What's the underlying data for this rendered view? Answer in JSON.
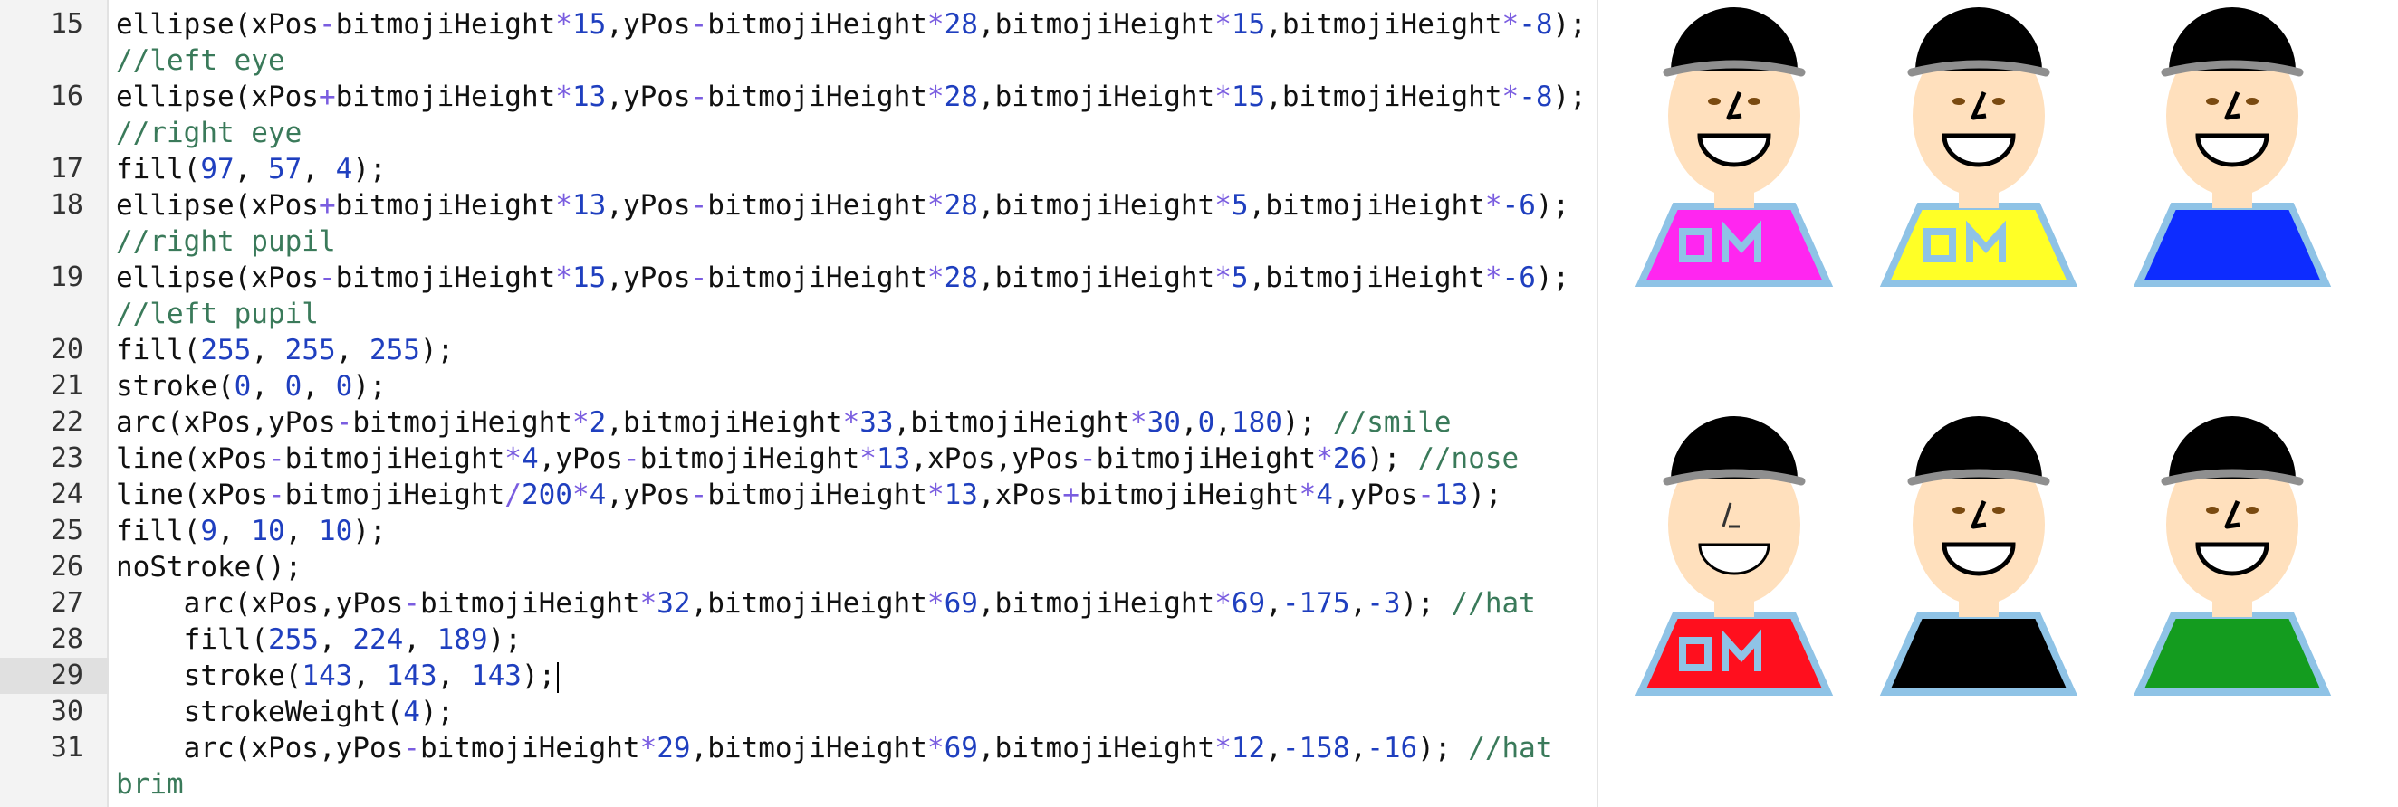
{
  "editor": {
    "active_line": "29",
    "lines": [
      {
        "n": "15",
        "tokens": [
          [
            "t",
            "ellipse(xPos"
          ],
          [
            "o",
            "-"
          ],
          [
            "t",
            "bitmojiHeight"
          ],
          [
            "o",
            "*"
          ],
          [
            "n",
            "15"
          ],
          [
            "t",
            ",yPos"
          ],
          [
            "o",
            "-"
          ],
          [
            "t",
            "bitmojiHeight"
          ],
          [
            "o",
            "*"
          ],
          [
            "n",
            "28"
          ],
          [
            "t",
            ",bitmojiHeight"
          ],
          [
            "o",
            "*"
          ],
          [
            "n",
            "15"
          ],
          [
            "t",
            ",bitmojiHeight"
          ],
          [
            "o",
            "*"
          ],
          [
            "n",
            "-8"
          ],
          [
            "t",
            ");"
          ]
        ]
      },
      {
        "n": "",
        "tokens": [
          [
            "c",
            "//left eye"
          ]
        ]
      },
      {
        "n": "16",
        "tokens": [
          [
            "t",
            "ellipse(xPos"
          ],
          [
            "o",
            "+"
          ],
          [
            "t",
            "bitmojiHeight"
          ],
          [
            "o",
            "*"
          ],
          [
            "n",
            "13"
          ],
          [
            "t",
            ",yPos"
          ],
          [
            "o",
            "-"
          ],
          [
            "t",
            "bitmojiHeight"
          ],
          [
            "o",
            "*"
          ],
          [
            "n",
            "28"
          ],
          [
            "t",
            ",bitmojiHeight"
          ],
          [
            "o",
            "*"
          ],
          [
            "n",
            "15"
          ],
          [
            "t",
            ",bitmojiHeight"
          ],
          [
            "o",
            "*"
          ],
          [
            "n",
            "-8"
          ],
          [
            "t",
            ");"
          ]
        ]
      },
      {
        "n": "",
        "tokens": [
          [
            "c",
            "//right eye"
          ]
        ]
      },
      {
        "n": "17",
        "tokens": [
          [
            "t",
            "fill("
          ],
          [
            "n",
            "97"
          ],
          [
            "t",
            ", "
          ],
          [
            "n",
            "57"
          ],
          [
            "t",
            ", "
          ],
          [
            "n",
            "4"
          ],
          [
            "t",
            ");"
          ]
        ]
      },
      {
        "n": "18",
        "tokens": [
          [
            "t",
            "ellipse(xPos"
          ],
          [
            "o",
            "+"
          ],
          [
            "t",
            "bitmojiHeight"
          ],
          [
            "o",
            "*"
          ],
          [
            "n",
            "13"
          ],
          [
            "t",
            ",yPos"
          ],
          [
            "o",
            "-"
          ],
          [
            "t",
            "bitmojiHeight"
          ],
          [
            "o",
            "*"
          ],
          [
            "n",
            "28"
          ],
          [
            "t",
            ",bitmojiHeight"
          ],
          [
            "o",
            "*"
          ],
          [
            "n",
            "5"
          ],
          [
            "t",
            ",bitmojiHeight"
          ],
          [
            "o",
            "*"
          ],
          [
            "n",
            "-6"
          ],
          [
            "t",
            ");"
          ]
        ]
      },
      {
        "n": "",
        "tokens": [
          [
            "c",
            "//right pupil"
          ]
        ]
      },
      {
        "n": "19",
        "tokens": [
          [
            "t",
            "ellipse(xPos"
          ],
          [
            "o",
            "-"
          ],
          [
            "t",
            "bitmojiHeight"
          ],
          [
            "o",
            "*"
          ],
          [
            "n",
            "15"
          ],
          [
            "t",
            ",yPos"
          ],
          [
            "o",
            "-"
          ],
          [
            "t",
            "bitmojiHeight"
          ],
          [
            "o",
            "*"
          ],
          [
            "n",
            "28"
          ],
          [
            "t",
            ",bitmojiHeight"
          ],
          [
            "o",
            "*"
          ],
          [
            "n",
            "5"
          ],
          [
            "t",
            ",bitmojiHeight"
          ],
          [
            "o",
            "*"
          ],
          [
            "n",
            "-6"
          ],
          [
            "t",
            ");"
          ]
        ]
      },
      {
        "n": "",
        "tokens": [
          [
            "c",
            "//left pupil"
          ]
        ]
      },
      {
        "n": "20",
        "tokens": [
          [
            "t",
            "fill("
          ],
          [
            "n",
            "255"
          ],
          [
            "t",
            ", "
          ],
          [
            "n",
            "255"
          ],
          [
            "t",
            ", "
          ],
          [
            "n",
            "255"
          ],
          [
            "t",
            ");"
          ]
        ]
      },
      {
        "n": "21",
        "tokens": [
          [
            "t",
            "stroke("
          ],
          [
            "n",
            "0"
          ],
          [
            "t",
            ", "
          ],
          [
            "n",
            "0"
          ],
          [
            "t",
            ", "
          ],
          [
            "n",
            "0"
          ],
          [
            "t",
            ");"
          ]
        ]
      },
      {
        "n": "22",
        "tokens": [
          [
            "t",
            "arc(xPos,yPos"
          ],
          [
            "o",
            "-"
          ],
          [
            "t",
            "bitmojiHeight"
          ],
          [
            "o",
            "*"
          ],
          [
            "n",
            "2"
          ],
          [
            "t",
            ",bitmojiHeight"
          ],
          [
            "o",
            "*"
          ],
          [
            "n",
            "33"
          ],
          [
            "t",
            ",bitmojiHeight"
          ],
          [
            "o",
            "*"
          ],
          [
            "n",
            "30"
          ],
          [
            "t",
            ","
          ],
          [
            "n",
            "0"
          ],
          [
            "t",
            ","
          ],
          [
            "n",
            "180"
          ],
          [
            "t",
            "); "
          ],
          [
            "c",
            "//smile"
          ]
        ]
      },
      {
        "n": "23",
        "tokens": [
          [
            "t",
            "line(xPos"
          ],
          [
            "o",
            "-"
          ],
          [
            "t",
            "bitmojiHeight"
          ],
          [
            "o",
            "*"
          ],
          [
            "n",
            "4"
          ],
          [
            "t",
            ",yPos"
          ],
          [
            "o",
            "-"
          ],
          [
            "t",
            "bitmojiHeight"
          ],
          [
            "o",
            "*"
          ],
          [
            "n",
            "13"
          ],
          [
            "t",
            ",xPos,yPos"
          ],
          [
            "o",
            "-"
          ],
          [
            "t",
            "bitmojiHeight"
          ],
          [
            "o",
            "*"
          ],
          [
            "n",
            "26"
          ],
          [
            "t",
            "); "
          ],
          [
            "c",
            "//nose"
          ]
        ]
      },
      {
        "n": "24",
        "tokens": [
          [
            "t",
            "line(xPos"
          ],
          [
            "o",
            "-"
          ],
          [
            "t",
            "bitmojiHeight"
          ],
          [
            "o",
            "/"
          ],
          [
            "n",
            "200"
          ],
          [
            "o",
            "*"
          ],
          [
            "n",
            "4"
          ],
          [
            "t",
            ",yPos"
          ],
          [
            "o",
            "-"
          ],
          [
            "t",
            "bitmojiHeight"
          ],
          [
            "o",
            "*"
          ],
          [
            "n",
            "13"
          ],
          [
            "t",
            ",xPos"
          ],
          [
            "o",
            "+"
          ],
          [
            "t",
            "bitmojiHeight"
          ],
          [
            "o",
            "*"
          ],
          [
            "n",
            "4"
          ],
          [
            "t",
            ",yPos"
          ],
          [
            "o",
            "-"
          ],
          [
            "n",
            "13"
          ],
          [
            "t",
            ");"
          ]
        ]
      },
      {
        "n": "25",
        "tokens": [
          [
            "t",
            "fill("
          ],
          [
            "n",
            "9"
          ],
          [
            "t",
            ", "
          ],
          [
            "n",
            "10"
          ],
          [
            "t",
            ", "
          ],
          [
            "n",
            "10"
          ],
          [
            "t",
            ");"
          ]
        ]
      },
      {
        "n": "26",
        "tokens": [
          [
            "t",
            "noStroke();"
          ]
        ]
      },
      {
        "n": "27",
        "tokens": [
          [
            "t",
            "    arc(xPos,yPos"
          ],
          [
            "o",
            "-"
          ],
          [
            "t",
            "bitmojiHeight"
          ],
          [
            "o",
            "*"
          ],
          [
            "n",
            "32"
          ],
          [
            "t",
            ",bitmojiHeight"
          ],
          [
            "o",
            "*"
          ],
          [
            "n",
            "69"
          ],
          [
            "t",
            ",bitmojiHeight"
          ],
          [
            "o",
            "*"
          ],
          [
            "n",
            "69"
          ],
          [
            "t",
            ","
          ],
          [
            "n",
            "-175"
          ],
          [
            "t",
            ","
          ],
          [
            "n",
            "-3"
          ],
          [
            "t",
            "); "
          ],
          [
            "c",
            "//hat"
          ]
        ]
      },
      {
        "n": "28",
        "tokens": [
          [
            "t",
            "    fill("
          ],
          [
            "n",
            "255"
          ],
          [
            "t",
            ", "
          ],
          [
            "n",
            "224"
          ],
          [
            "t",
            ", "
          ],
          [
            "n",
            "189"
          ],
          [
            "t",
            ");"
          ]
        ]
      },
      {
        "n": "29",
        "tokens": [
          [
            "t",
            "    stroke("
          ],
          [
            "n",
            "143"
          ],
          [
            "t",
            ", "
          ],
          [
            "n",
            "143"
          ],
          [
            "t",
            ", "
          ],
          [
            "n",
            "143"
          ],
          [
            "t",
            ");"
          ]
        ]
      },
      {
        "n": "30",
        "tokens": [
          [
            "t",
            "    strokeWeight("
          ],
          [
            "n",
            "4"
          ],
          [
            "t",
            ");"
          ]
        ]
      },
      {
        "n": "31",
        "tokens": [
          [
            "t",
            "    arc(xPos,yPos"
          ],
          [
            "o",
            "-"
          ],
          [
            "t",
            "bitmojiHeight"
          ],
          [
            "o",
            "*"
          ],
          [
            "n",
            "29"
          ],
          [
            "t",
            ",bitmojiHeight"
          ],
          [
            "o",
            "*"
          ],
          [
            "n",
            "69"
          ],
          [
            "t",
            ",bitmojiHeight"
          ],
          [
            "o",
            "*"
          ],
          [
            "n",
            "12"
          ],
          [
            "t",
            ","
          ],
          [
            "n",
            "-158"
          ],
          [
            "t",
            ","
          ],
          [
            "n",
            "-16"
          ],
          [
            "t",
            "); "
          ],
          [
            "c",
            "//hat"
          ]
        ]
      },
      {
        "n": "",
        "tokens": [
          [
            "c",
            "brim"
          ]
        ]
      }
    ]
  },
  "preview": {
    "colors": {
      "hat": "#000000",
      "hat_brim": "#8f8f8f",
      "skin": "#ffe0bd",
      "outline": "#8fc3e6",
      "initials_stroke": "#8fc3e6"
    },
    "bitmojis": [
      {
        "shirt": "#ff26f0",
        "initials": "OM",
        "face": "normal"
      },
      {
        "shirt": "#ffff26",
        "initials": "OM",
        "face": "normal"
      },
      {
        "shirt": "#0d2cff",
        "initials": "",
        "face": "normal"
      },
      {
        "shirt": "#ff0f1e",
        "initials": "OM",
        "face": "wink"
      },
      {
        "shirt": "#000000",
        "initials": "",
        "face": "eyes"
      },
      {
        "shirt": "#149c1f",
        "initials": "",
        "face": "eyes"
      }
    ]
  }
}
